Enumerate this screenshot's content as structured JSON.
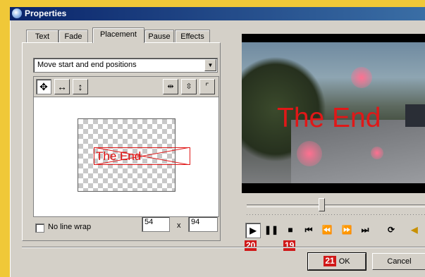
{
  "window": {
    "title": "Properties"
  },
  "tabs": [
    {
      "label": "Text",
      "active": false
    },
    {
      "label": "Fade",
      "active": false
    },
    {
      "label": "Placement",
      "active": true
    },
    {
      "label": "Pause",
      "active": false
    },
    {
      "label": "Effects",
      "active": false
    }
  ],
  "placement": {
    "mode_select": "Move start and end positions",
    "tool_icons": [
      "move-icon",
      "horizontal-move-icon",
      "vertical-move-icon",
      "center-horizontal-icon",
      "center-vertical-icon",
      "corner-align-icon"
    ],
    "preview_text": "The End",
    "no_line_wrap_label": "No line wrap",
    "no_line_wrap_checked": false,
    "x_value": "54",
    "times_label": "x",
    "y_value": "94"
  },
  "video": {
    "overlay_text": "The End"
  },
  "player": {
    "buttons": [
      "play-icon",
      "pause-icon",
      "stop-icon",
      "skip-start-icon",
      "rewind-icon",
      "fast-forward-icon",
      "skip-end-icon",
      "loop-icon",
      "volume-icon"
    ],
    "position_fraction": 0.42
  },
  "callouts": {
    "play": "20",
    "stop": "19",
    "ok": "21"
  },
  "buttons": {
    "ok": "OK",
    "cancel": "Cancel"
  },
  "colors": {
    "accent_red": "#e01818",
    "callout_red": "#d01818",
    "title_blue": "#0a246a",
    "background_yellow": "#f0c838"
  }
}
